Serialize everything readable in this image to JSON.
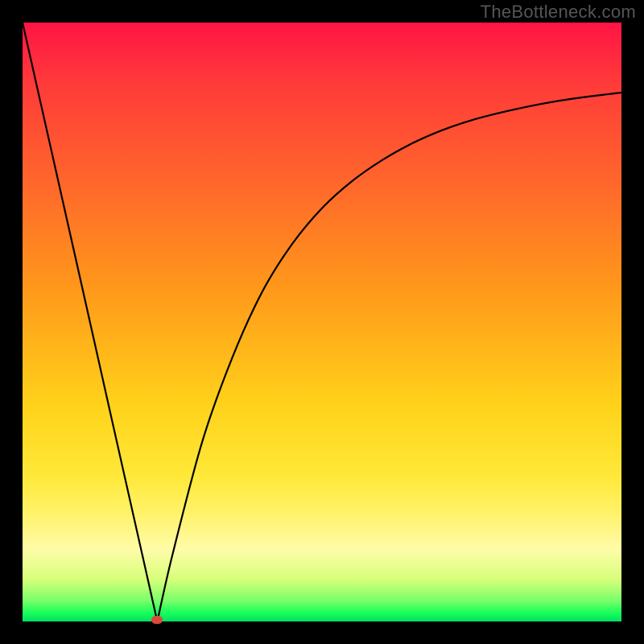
{
  "watermark": "TheBottleneck.com",
  "chart_data": {
    "type": "line",
    "title": "",
    "xlabel": "",
    "ylabel": "",
    "xlim": [
      0,
      100
    ],
    "ylim": [
      0,
      100
    ],
    "grid": false,
    "legend": false,
    "optimal_point": {
      "x": 22.5,
      "y": 0
    },
    "series": [
      {
        "name": "bottleneck-curve",
        "x": [
          0,
          5,
          10,
          15,
          20,
          22.5,
          25,
          30,
          35,
          40,
          45,
          50,
          55,
          60,
          65,
          70,
          75,
          80,
          85,
          90,
          95,
          100
        ],
        "values": [
          100,
          77.8,
          55.6,
          33.3,
          11.1,
          0,
          11,
          30,
          44,
          55,
          63,
          69,
          73.5,
          77,
          79.8,
          82,
          83.7,
          85,
          86.1,
          87,
          87.7,
          88.3
        ]
      }
    ],
    "background_gradient_stops": [
      {
        "pos": 0,
        "color": "#ff1444"
      },
      {
        "pos": 10,
        "color": "#ff3a3a"
      },
      {
        "pos": 28,
        "color": "#ff6a2a"
      },
      {
        "pos": 45,
        "color": "#ff9a1a"
      },
      {
        "pos": 64,
        "color": "#ffd21a"
      },
      {
        "pos": 76,
        "color": "#ffe93a"
      },
      {
        "pos": 82,
        "color": "#fff26a"
      },
      {
        "pos": 88,
        "color": "#fffca8"
      },
      {
        "pos": 93,
        "color": "#d6ff7a"
      },
      {
        "pos": 96.5,
        "color": "#7aff6a"
      },
      {
        "pos": 98.5,
        "color": "#1aff5a"
      },
      {
        "pos": 100,
        "color": "#00e060"
      }
    ]
  },
  "colors": {
    "frame": "#000000",
    "curve": "#000000",
    "marker": "#d84a3a",
    "watermark": "#555555"
  }
}
